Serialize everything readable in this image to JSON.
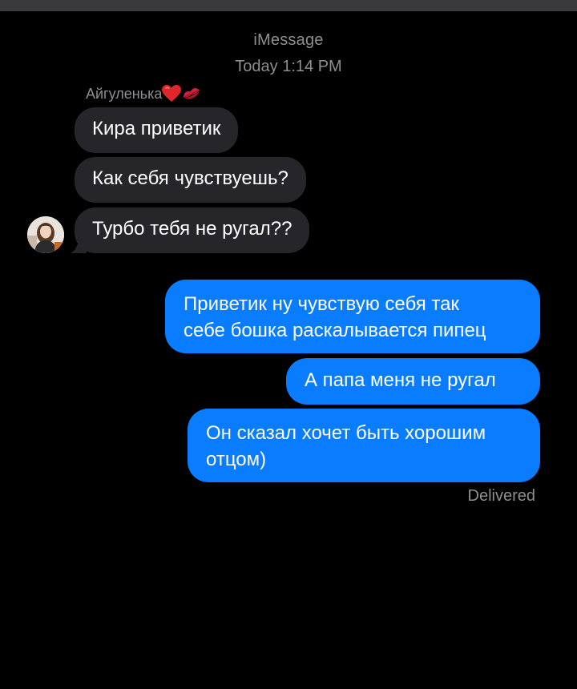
{
  "header": {
    "service": "iMessage",
    "timestamp": "Today 1:14 PM"
  },
  "sender": {
    "name": "Айгуленька",
    "emoji_icons": [
      "red-heart-icon",
      "kiss-mark-icon"
    ]
  },
  "incoming": [
    {
      "text": "Кира приветик"
    },
    {
      "text": "Как себя чувствуешь?"
    },
    {
      "text": "Турбо тебя не ругал??"
    }
  ],
  "outgoing": [
    {
      "line1": "Приветик ну чувствую себя так",
      "line2": "себе бошка раскалывается пипец"
    },
    {
      "text": "А папа меня не ругал"
    },
    {
      "line1": "Он сказал хочет быть хорошим",
      "line2": "отцом)"
    }
  ],
  "status": "Delivered",
  "colors": {
    "background": "#000000",
    "incoming_bubble": "#26252a",
    "outgoing_bubble": "#0a7cff",
    "meta_text": "#8e8e93"
  }
}
